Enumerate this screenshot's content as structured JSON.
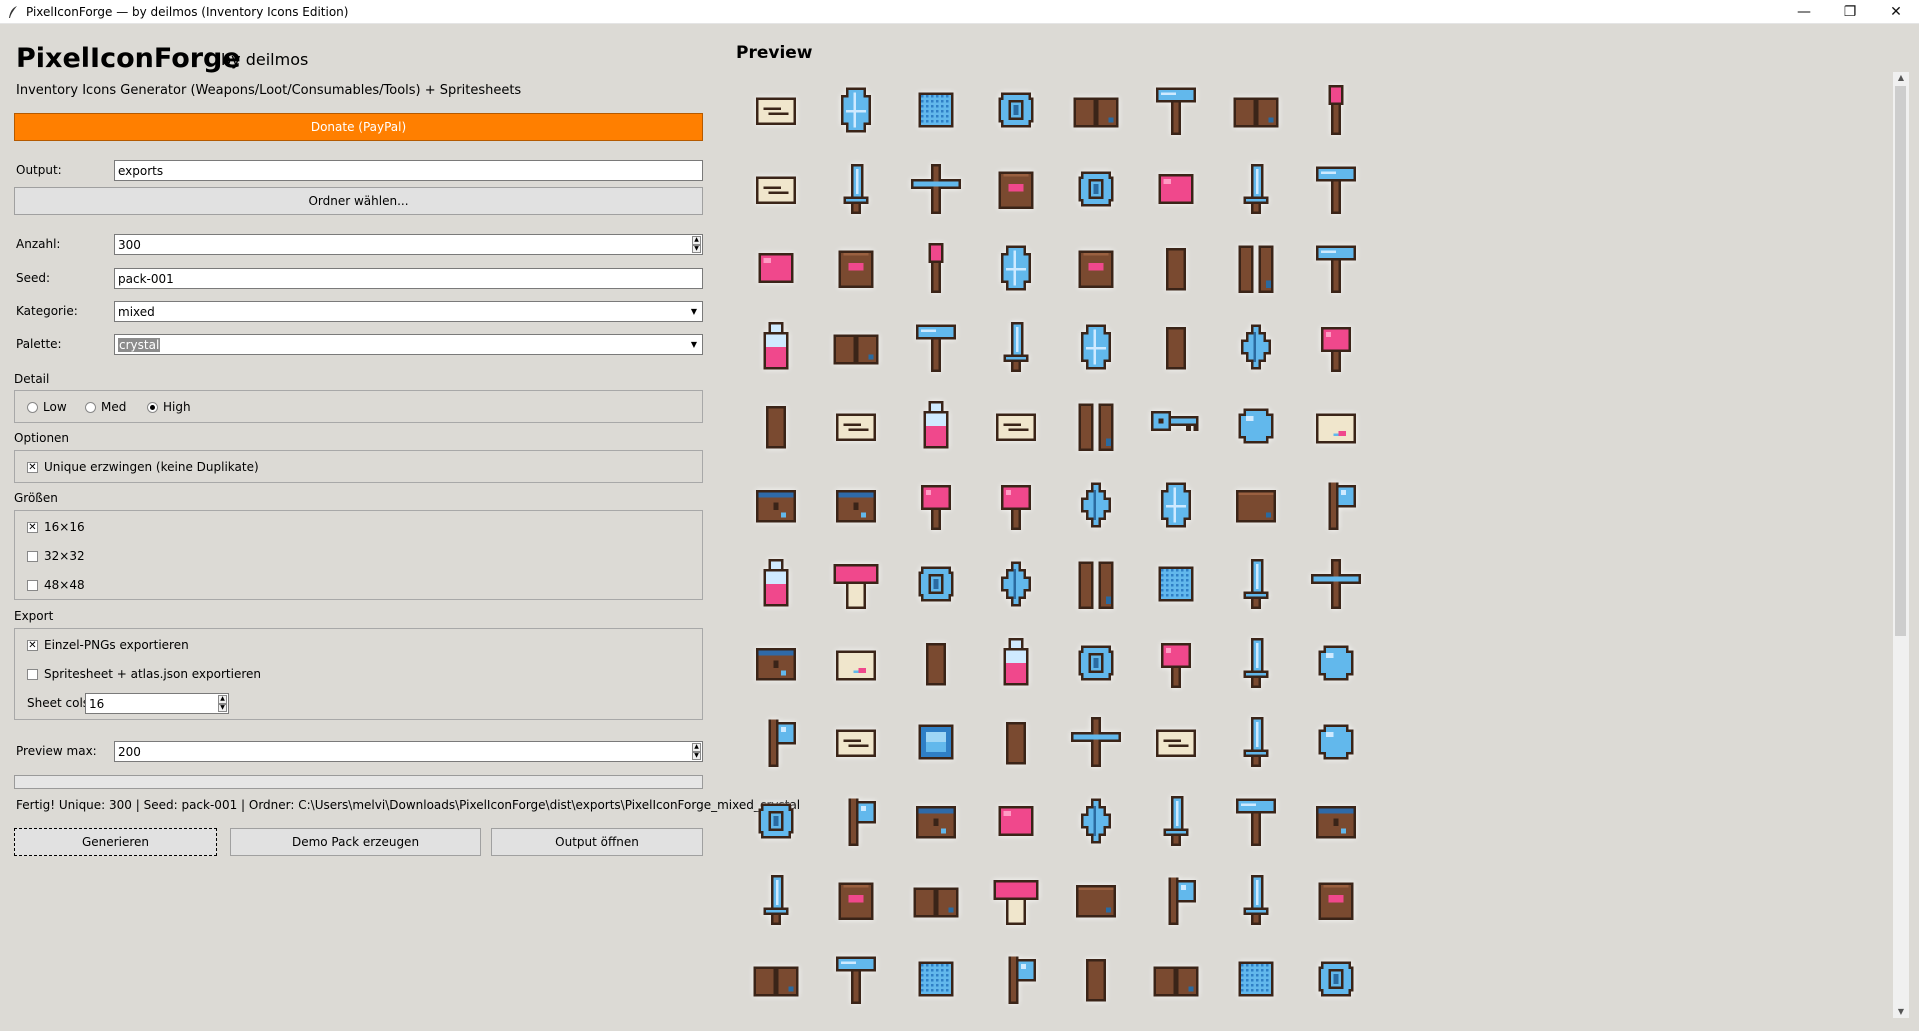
{
  "window": {
    "title": "PixelIconForge — by deilmos (Inventory Icons Edition)",
    "minimize": "—",
    "maximize": "❐",
    "close": "✕"
  },
  "header": {
    "title": "PixelIconForge",
    "by": "by deilmos",
    "subtitle": "Inventory Icons Generator (Weapons/Loot/Consumables/Tools) + Spritesheets"
  },
  "donate_label": "Donate (PayPal)",
  "output": {
    "label": "Output:",
    "value": "exports",
    "choose_label": "Ordner wählen..."
  },
  "count": {
    "label": "Anzahl:",
    "value": "300"
  },
  "seed": {
    "label": "Seed:",
    "value": "pack-001"
  },
  "category": {
    "label": "Kategorie:",
    "value": "mixed"
  },
  "palette": {
    "label": "Palette:",
    "value": "crystal"
  },
  "detail": {
    "label": "Detail",
    "options": [
      "Low",
      "Med",
      "High"
    ],
    "selected": "High"
  },
  "options": {
    "label": "Optionen",
    "unique_label": "Unique erzwingen (keine Duplikate)",
    "unique_checked": true
  },
  "sizes": {
    "label": "Größen",
    "items": [
      {
        "label": "16×16",
        "checked": true
      },
      {
        "label": "32×32",
        "checked": false
      },
      {
        "label": "48×48",
        "checked": false
      }
    ]
  },
  "export": {
    "label": "Export",
    "png_label": "Einzel-PNGs exportieren",
    "png_checked": true,
    "sheet_label": "Spritesheet + atlas.json exportieren",
    "sheet_checked": false,
    "cols_label": "Sheet cols:",
    "cols_value": "16"
  },
  "preview_max": {
    "label": "Preview max:",
    "value": "200"
  },
  "progress": 0,
  "status": "Fertig! Unique: 300 | Seed: pack-001 | Ordner: C:\\Users\\melvi\\Downloads\\PixelIconForge\\dist\\exports\\PixelIconForge_mixed_crystal",
  "buttons": {
    "generate": "Generieren",
    "demo": "Demo Pack erzeugen",
    "open_output": "Output öffnen"
  },
  "preview": {
    "title": "Preview",
    "icons": [
      [
        "scroll",
        "crystal",
        "grid",
        "coin",
        "book",
        "hammer",
        "book",
        "torch"
      ],
      [
        "scroll",
        "sword",
        "cross",
        "pouch",
        "coin",
        "gem",
        "sword",
        "hammer"
      ],
      [
        "gem",
        "pouch",
        "torch",
        "crystal",
        "pouch",
        "plank",
        "double-plank",
        "hammer"
      ],
      [
        "potion",
        "book",
        "hammer",
        "sword",
        "crystal",
        "plank",
        "diamond",
        "flower"
      ],
      [
        "plank",
        "scroll",
        "potion",
        "scroll",
        "double-plank",
        "key",
        "orb",
        "letter"
      ],
      [
        "chest",
        "chest",
        "flower",
        "flower",
        "diamond",
        "crystal",
        "box",
        "axe"
      ],
      [
        "potion",
        "mushroom",
        "coin",
        "diamond",
        "double-plank",
        "grid",
        "sword",
        "cross"
      ],
      [
        "chest",
        "letter",
        "plank",
        "potion",
        "coin",
        "flower",
        "sword",
        "orb"
      ],
      [
        "axe",
        "scroll",
        "frame",
        "plank",
        "cross",
        "scroll",
        "sword",
        "orb"
      ],
      [
        "coin",
        "axe",
        "chest",
        "gem",
        "diamond",
        "sword",
        "hammer",
        "chest"
      ],
      [
        "sword",
        "pouch",
        "book",
        "mushroom",
        "box",
        "axe",
        "sword",
        "pouch"
      ],
      [
        "book",
        "hammer",
        "grid",
        "axe",
        "plank",
        "book",
        "grid",
        "coin"
      ]
    ]
  },
  "colors": {
    "outline": "#3a2418",
    "wood": "#7a4a30",
    "ice": "#62b8ec",
    "pink": "#f0488c",
    "paper": "#f0e6cc",
    "accent": "#ff7f00"
  }
}
